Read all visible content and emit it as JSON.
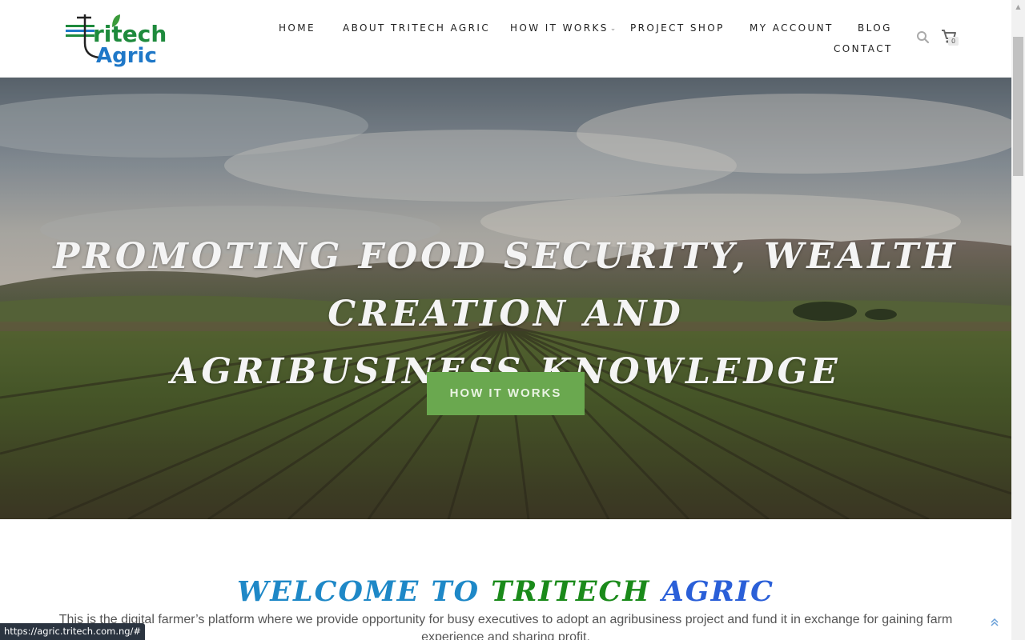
{
  "header": {
    "logo": {
      "line1": "ritech",
      "line2": "Agric",
      "brand_green": "#1e8a3c",
      "brand_blue": "#1f78c8"
    },
    "nav": {
      "home": "HOME",
      "about": "ABOUT TRITECH AGRIC",
      "how_it_works": "HOW IT WORKS",
      "project_shop": "PROJECT SHOP",
      "my_account": "MY ACCOUNT",
      "blog": "BLOG",
      "contact": "CONTACT"
    },
    "search_icon": "search-icon",
    "cart": {
      "icon": "shopping-cart-icon",
      "count": "0"
    }
  },
  "hero": {
    "title_line1": "PROMOTING FOOD SECURITY, WEALTH CREATION AND",
    "title_line2": "AGRIBUSINESS KNOWLEDGE",
    "button_label": "HOW IT WORKS",
    "button_color": "#6aa84f"
  },
  "welcome": {
    "title_part1": "WELCOME TO",
    "title_part2": "TRITECH",
    "title_part3": "AGRIC",
    "text": "This is the digital farmer’s platform where we provide opportunity for busy executives to adopt an agribusiness project and fund it in exchange for gaining farm experience and sharing profit."
  },
  "back_to_top_icon": "double-chevron-up-icon",
  "status_bar": {
    "url": "https://agric.tritech.com.ng/#"
  }
}
